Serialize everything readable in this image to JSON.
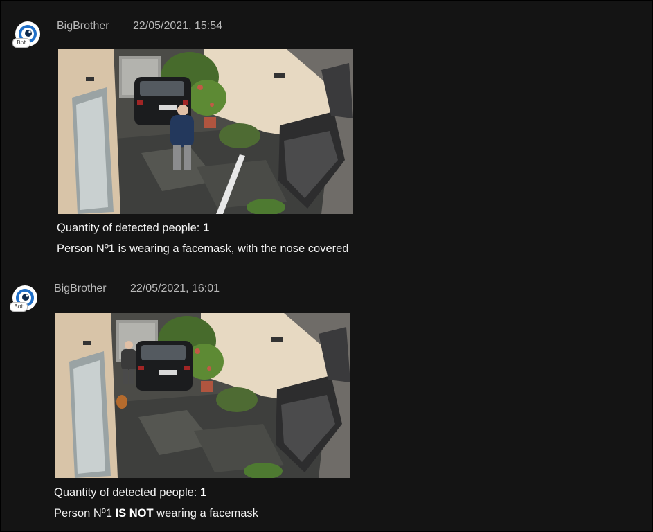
{
  "messages": [
    {
      "avatar_badge": "Bot",
      "avatar_icon": "eye-icon",
      "sender": "BigBrother",
      "timestamp": "22/05/2021, 15:54",
      "image_description": "security-camera-snapshot",
      "count_label": "Quantity of detected people: ",
      "count_value": "1",
      "status_prefix": "Person Nº1 is wearing a facemask, with the nose covered",
      "status_emphasis": "",
      "status_suffix": ""
    },
    {
      "avatar_badge": "Bot",
      "avatar_icon": "eye-icon",
      "sender": "BigBrother",
      "timestamp": "22/05/2021, 16:01",
      "image_description": "security-camera-snapshot",
      "count_label": "Quantity of detected people: ",
      "count_value": "1",
      "status_prefix": "Person Nº1 ",
      "status_emphasis": "IS NOT",
      "status_suffix": " wearing a facemask"
    }
  ],
  "colors": {
    "background": "#141414",
    "meta_text": "#b9b9b9",
    "body_text": "#f2f2f2",
    "avatar_ring": "#2f7fd0"
  }
}
